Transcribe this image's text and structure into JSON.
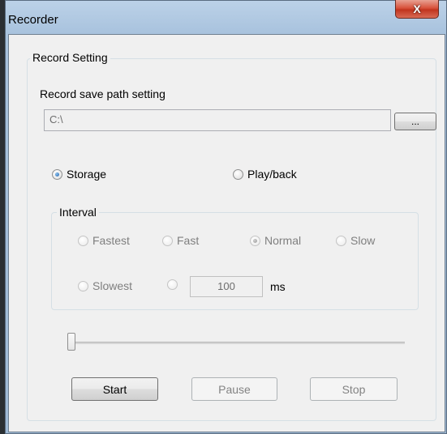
{
  "window": {
    "title": "Recorder",
    "close_glyph": "X"
  },
  "record_setting": {
    "group_title": "Record Setting",
    "path_label": "Record save path setting",
    "path_value": "C:\\",
    "browse_label": "...",
    "mode_options": [
      {
        "label": "Storage",
        "checked": true
      },
      {
        "label": "Play/back",
        "checked": false
      }
    ]
  },
  "interval": {
    "group_title": "Interval",
    "options": [
      {
        "label": "Fastest",
        "checked": false
      },
      {
        "label": "Fast",
        "checked": false
      },
      {
        "label": "Normal",
        "checked": true
      },
      {
        "label": "Slow",
        "checked": false
      },
      {
        "label": "Slowest",
        "checked": false
      }
    ],
    "custom_value": "100",
    "custom_unit": "ms"
  },
  "progress": {
    "position_fraction": 0.0
  },
  "actions": {
    "start_label": "Start",
    "pause_label": "Pause",
    "stop_label": "Stop"
  }
}
